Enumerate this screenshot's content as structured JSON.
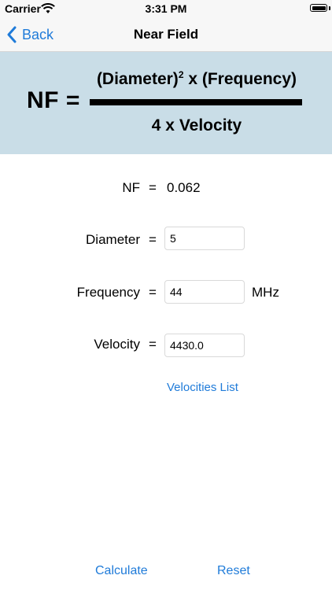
{
  "status_bar": {
    "carrier": "Carrier",
    "time": "3:31 PM"
  },
  "nav": {
    "back_label": "Back",
    "title": "Near Field"
  },
  "formula": {
    "lhs": "NF =",
    "numerator_base": "(Diameter)",
    "numerator_exp": "2",
    "numerator_rest": " x (Frequency)",
    "denominator": "4 x Velocity"
  },
  "result": {
    "label": "NF",
    "equals": "=",
    "value": "0.062"
  },
  "inputs": {
    "diameter": {
      "label": "Diameter",
      "equals": "=",
      "value": "5"
    },
    "frequency": {
      "label": "Frequency",
      "equals": "=",
      "value": "44",
      "unit": "MHz"
    },
    "velocity": {
      "label": "Velocity",
      "equals": "=",
      "value": "4430.0"
    }
  },
  "velocities_link": "Velocities List",
  "actions": {
    "calculate": "Calculate",
    "reset": "Reset"
  },
  "colors": {
    "accent": "#1f7bd9",
    "formula_bg": "#c9dde7",
    "nav_bg": "#f7f7f7"
  },
  "icons": {
    "back": "chevron-left-icon",
    "wifi": "wifi-icon",
    "battery": "battery-icon"
  }
}
